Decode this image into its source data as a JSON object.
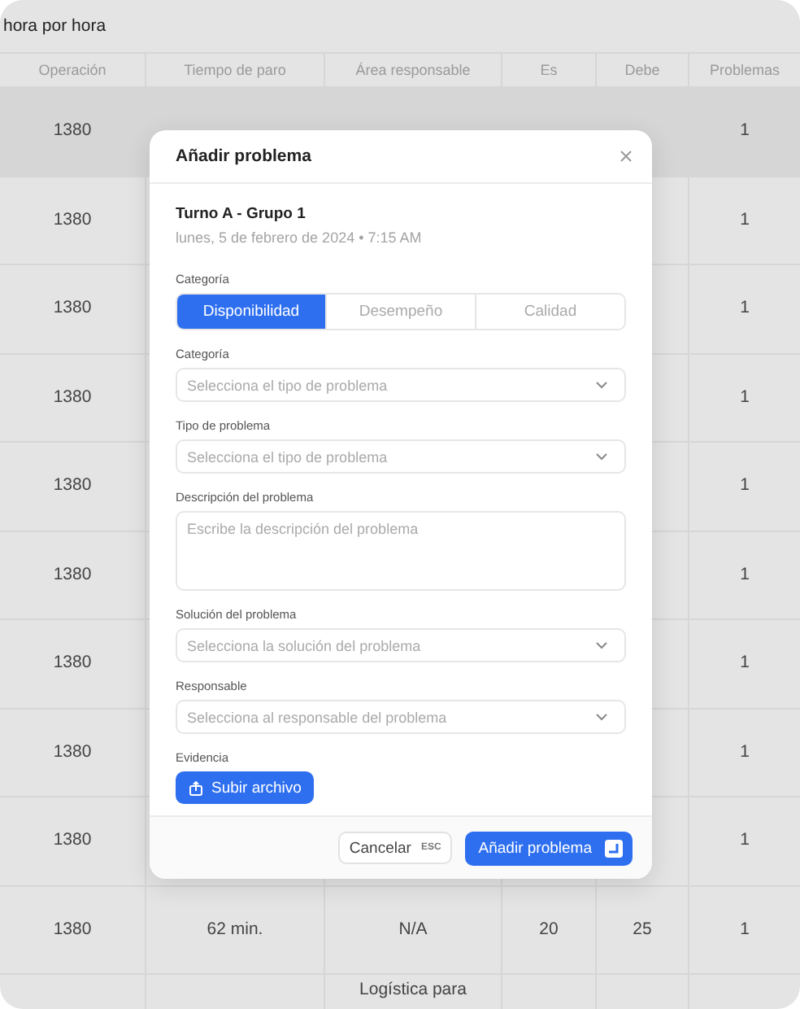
{
  "page": {
    "title": "hora por hora"
  },
  "table": {
    "columns": [
      "Operación",
      "Tiempo de paro",
      "Área responsable",
      "Es",
      "Debe",
      "Problemas"
    ],
    "rows": [
      {
        "selected": true,
        "operacion": "1380",
        "problemas": "1"
      },
      {
        "selected": false,
        "operacion": "1380",
        "problemas": "1"
      },
      {
        "selected": false,
        "operacion": "1380",
        "problemas": "1"
      },
      {
        "selected": false,
        "operacion": "1380",
        "problemas": "1"
      },
      {
        "selected": false,
        "operacion": "1380",
        "problemas": "1"
      },
      {
        "selected": false,
        "operacion": "1380",
        "problemas": "1"
      },
      {
        "selected": false,
        "operacion": "1380",
        "problemas": "1"
      },
      {
        "selected": false,
        "operacion": "1380",
        "problemas": "1"
      },
      {
        "selected": false,
        "operacion": "1380",
        "problemas": "1"
      },
      {
        "selected": false,
        "operacion": "1380",
        "tiempo": "62 min.",
        "area": "N/A",
        "es": "20",
        "debe": "25",
        "problemas": "1"
      },
      {
        "selected": false,
        "area": "Logística para"
      }
    ]
  },
  "dialog": {
    "title": "Añadir problema",
    "shift": "Turno A - Grupo 1",
    "date": "lunes, 5 de febrero de 2024 • 7:15 AM",
    "category_label": "Categoría",
    "category_options": [
      {
        "label": "Disponibilidad",
        "selected": true
      },
      {
        "label": "Desempeño",
        "selected": false
      },
      {
        "label": "Calidad",
        "selected": false
      }
    ],
    "fields": [
      {
        "kind": "select",
        "label": "Categoría",
        "placeholder": "Selecciona el tipo de problema"
      },
      {
        "kind": "select",
        "label": "Tipo de problema",
        "placeholder": "Selecciona el tipo de problema"
      },
      {
        "kind": "textarea",
        "label": "Descripción del problema",
        "placeholder": "Escribe la descripción del problema"
      },
      {
        "kind": "select",
        "label": "Solución del problema",
        "placeholder": "Selecciona la solución del problema"
      },
      {
        "kind": "select",
        "label": "Responsable",
        "placeholder": "Selecciona al responsable del problema"
      },
      {
        "kind": "upload",
        "label": "Evidencia",
        "button": "Subir archivo"
      }
    ],
    "cancel": {
      "label": "Cancelar",
      "shortcut": "ESC"
    },
    "submit": {
      "label": "Añadir problema"
    }
  }
}
